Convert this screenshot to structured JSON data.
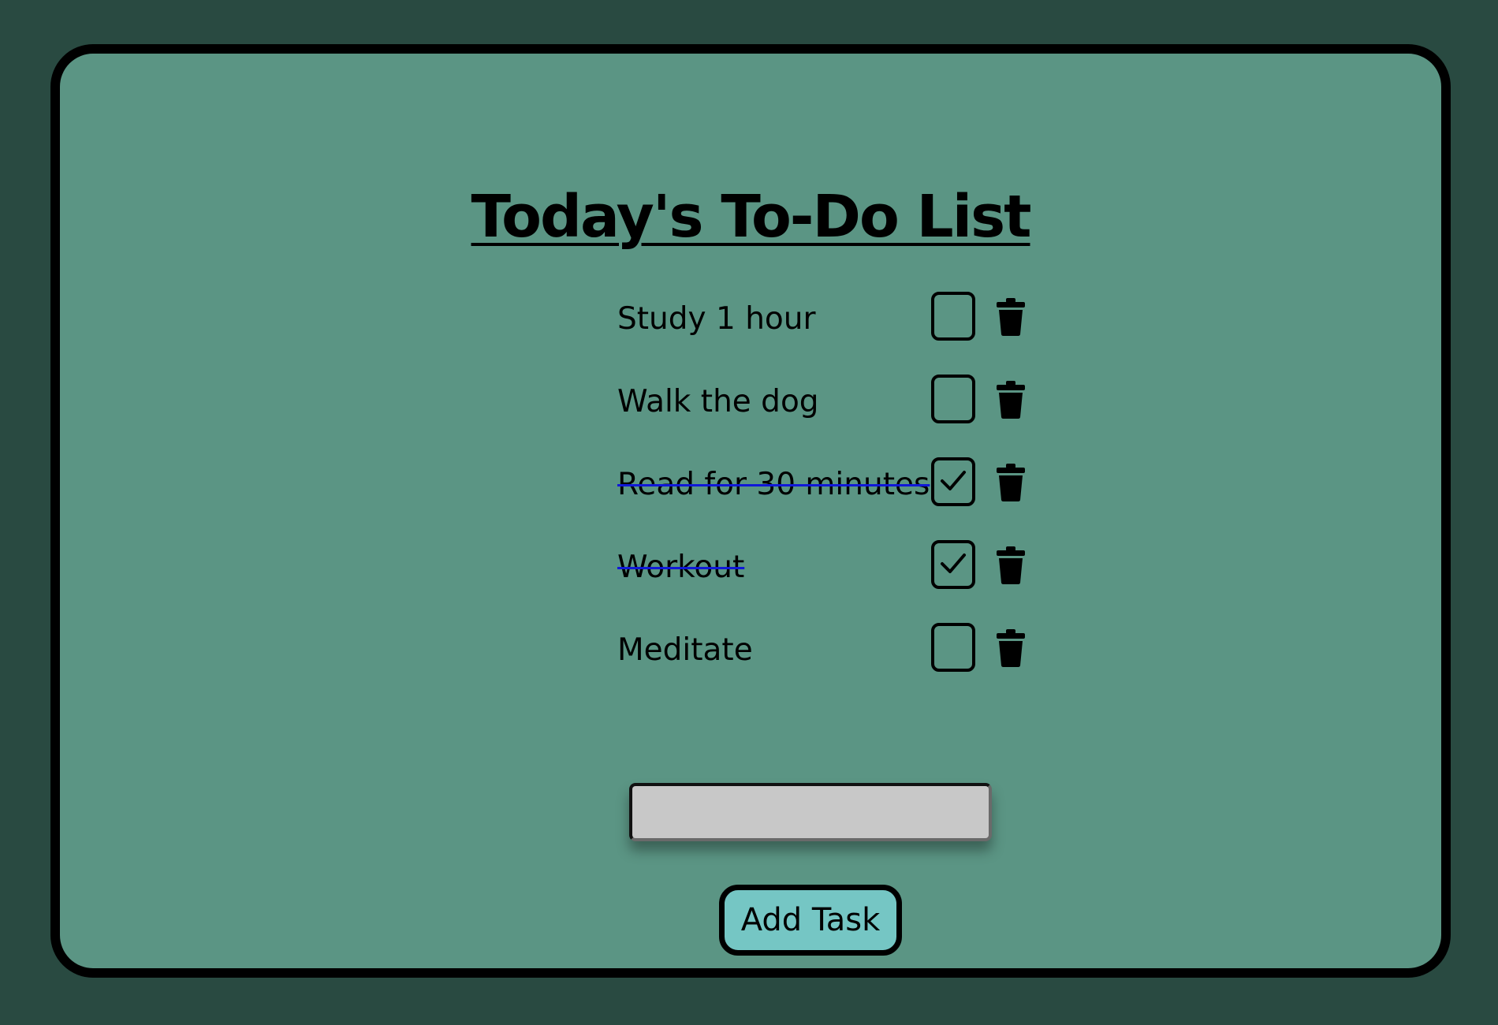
{
  "app": {
    "title": "Today's To-Do List"
  },
  "tasks": [
    {
      "text": "Study 1 hour",
      "completed": false
    },
    {
      "text": "Walk the dog",
      "completed": false
    },
    {
      "text": "Read for 30 minutes",
      "completed": true
    },
    {
      "text": "Workout",
      "completed": true
    },
    {
      "text": "Meditate",
      "completed": false
    }
  ],
  "new_task": {
    "value": "",
    "placeholder": ""
  },
  "add_button": {
    "label": "Add Task"
  },
  "icons": {
    "checkbox": "checkbox-icon",
    "checkmark": "checkmark-icon",
    "delete": "trash-icon"
  },
  "colors": {
    "background": "#294a41",
    "card": "#5b9584",
    "card_border": "#000000",
    "strikethrough": "#1018d8",
    "input_background": "#c8c8c8",
    "button_background": "#75c6c4"
  }
}
